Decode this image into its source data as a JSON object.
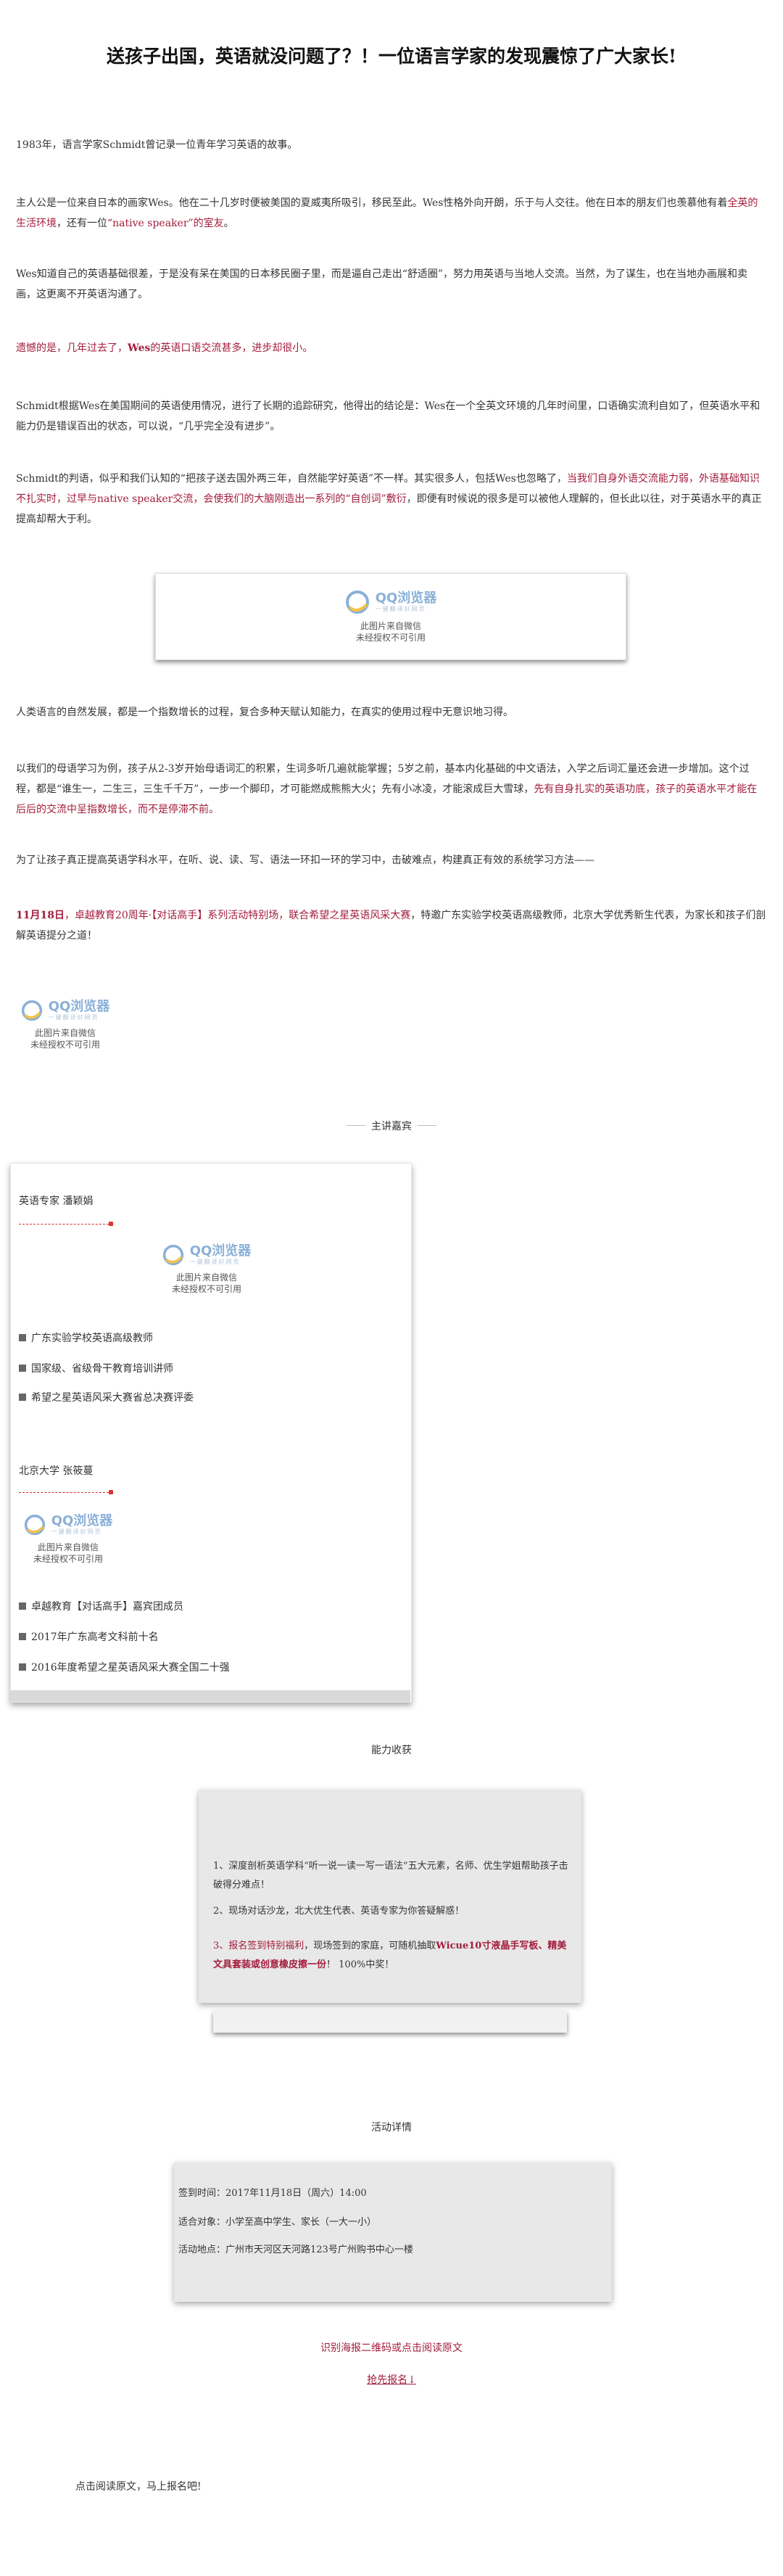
{
  "title": "送孩子出国，英语就没问题了？！一位语言学家的发现震惊了广大家长!",
  "p1": "1983年，语言学家Schmidt曾记录一位青年学习英语的故事。",
  "p2": {
    "a": "主人公是一位来自日本的画家Wes。他在二十几岁时便被美国的夏威夷所吸引，移民至此。Wes性格外向开朗，乐于与人交往。他在日本的朋友们也羡慕他有着",
    "b": "全英的生活环境",
    "c": "，还有一位",
    "d": "“native speaker”的室友",
    "e": "。"
  },
  "p3": "Wes知道自己的英语基础很差，于是没有呆在美国的日本移民圈子里，而是逼自己走出“舒适圈”，努力用英语与当地人交流。当然，为了谋生，也在当地办画展和卖画，这更离不开英语沟通了。",
  "p4": {
    "a": "遗憾的是，几年过去了，",
    "b": "Wes",
    "c": "的英语口语交流甚多，进步却很小。"
  },
  "p5": "Schmidt根据Wes在美国期间的英语使用情况，进行了长期的追踪研究，他得出的结论是：Wes在一个全英文环境的几年时间里，口语确实流利自如了，但英语水平和能力仍是错误百出的状态，可以说，“几乎完全没有进步”。",
  "p6": {
    "a": "Schmidt的判语，似乎和我们认知的“把孩子送去国外两三年，自然能学好英语”不一样。其实很多人，包括Wes也忽略了，",
    "b": "当我们自身外语交流能力弱，外语基础知识不扎实时，过早与native  speaker交流，会使我们的大脑刚造出一系列的“自创词”敷衍",
    "c": "，即便有时候说的很多是可以被他人理解的，但长此以往，对于英语水平的真正提高却帮大于利。"
  },
  "img_caption_1": "此图片来自微信",
  "img_caption_2": "未经授权不可引用",
  "img_brand": "QQ浏览器",
  "img_brand_sub": "一键翻译好网页",
  "p7": "人类语言的自然发展，都是一个指数增长的过程，复合多种天赋认知能力，在真实的使用过程中无意识地习得。",
  "p8": {
    "a": "以我们的母语学习为例，孩子从2-3岁开始母语词汇的积累，生词多听几遍就能掌握；5岁之前，基本内化基础的中文语法，入学之后词汇量还会进一步增加。这个过程，都是“谁生一，二生三，三生千千万”，一步一个脚印，才可能燃成熊熊大火；先有小冰凌，才能滚成巨大雪球，",
    "b": "先有自身扎实的英语功底，孩子的英语水平才能在后后的交流中呈指数增长，而不是停滞不前。"
  },
  "p9": "为了让孩子真正提高英语学科水平，在听、说、读、写、语法一环扣一环的学习中，击破难点，构建真正有效的系统学习方法——",
  "p10": {
    "a": "11月18日",
    "b": "，卓越教育20周年·【对话高手】系列活动特别场，联合希望之星英语风采大赛",
    "c": "，特邀广东实验学校英语高级教师，北京大学优秀新生代表，为家长和孩子们剖解英语提分之道！"
  },
  "section_speakers": "主讲嘉宾",
  "speaker1": {
    "name": "英语专家 潘颖娟",
    "items": [
      "广东实验学校英语高级教师",
      "国家级、省级骨干教育培训讲师",
      "希望之星英语风采大赛省总决赛评委"
    ]
  },
  "speaker2": {
    "name": "北京大学 张筱蔓",
    "items": [
      "卓越教育【对话高手】嘉宾团成员",
      "2017年广东高考文科前十名",
      "2016年度希望之星英语风采大赛全国二十强"
    ]
  },
  "section_gain": "能力收获",
  "gain": {
    "item1": "1、深度剖析英语学科“听一说一读一写一语法”五大元素，名师、优生学姐帮助孩子击破得分难点！",
    "item2": "2、现场对话沙龙，北大优生代表、英语专家为你答疑解惑！",
    "item3a": "3、报名签到特别福利",
    "item3b": "，现场签到的家庭，可随机抽取",
    "item3c": "Wicue10寸液晶手写板、精美文具套装或创意橡皮擦一份",
    "item3d": "！ 100%中奖！"
  },
  "section_detail": "活动详情",
  "detail": {
    "time": "签到时间：2017年11月18日（周六）14:00",
    "audience": "适合对象：小学至高中学生、家长（一大一小）",
    "place": "活动地点：广州市天河区天河路123号广州购书中心一楼"
  },
  "cta_text": "识别海报二维码或点击阅读原文",
  "cta_link": "抢先报名↓",
  "footer": "点击阅读原文，马上报名吧!"
}
